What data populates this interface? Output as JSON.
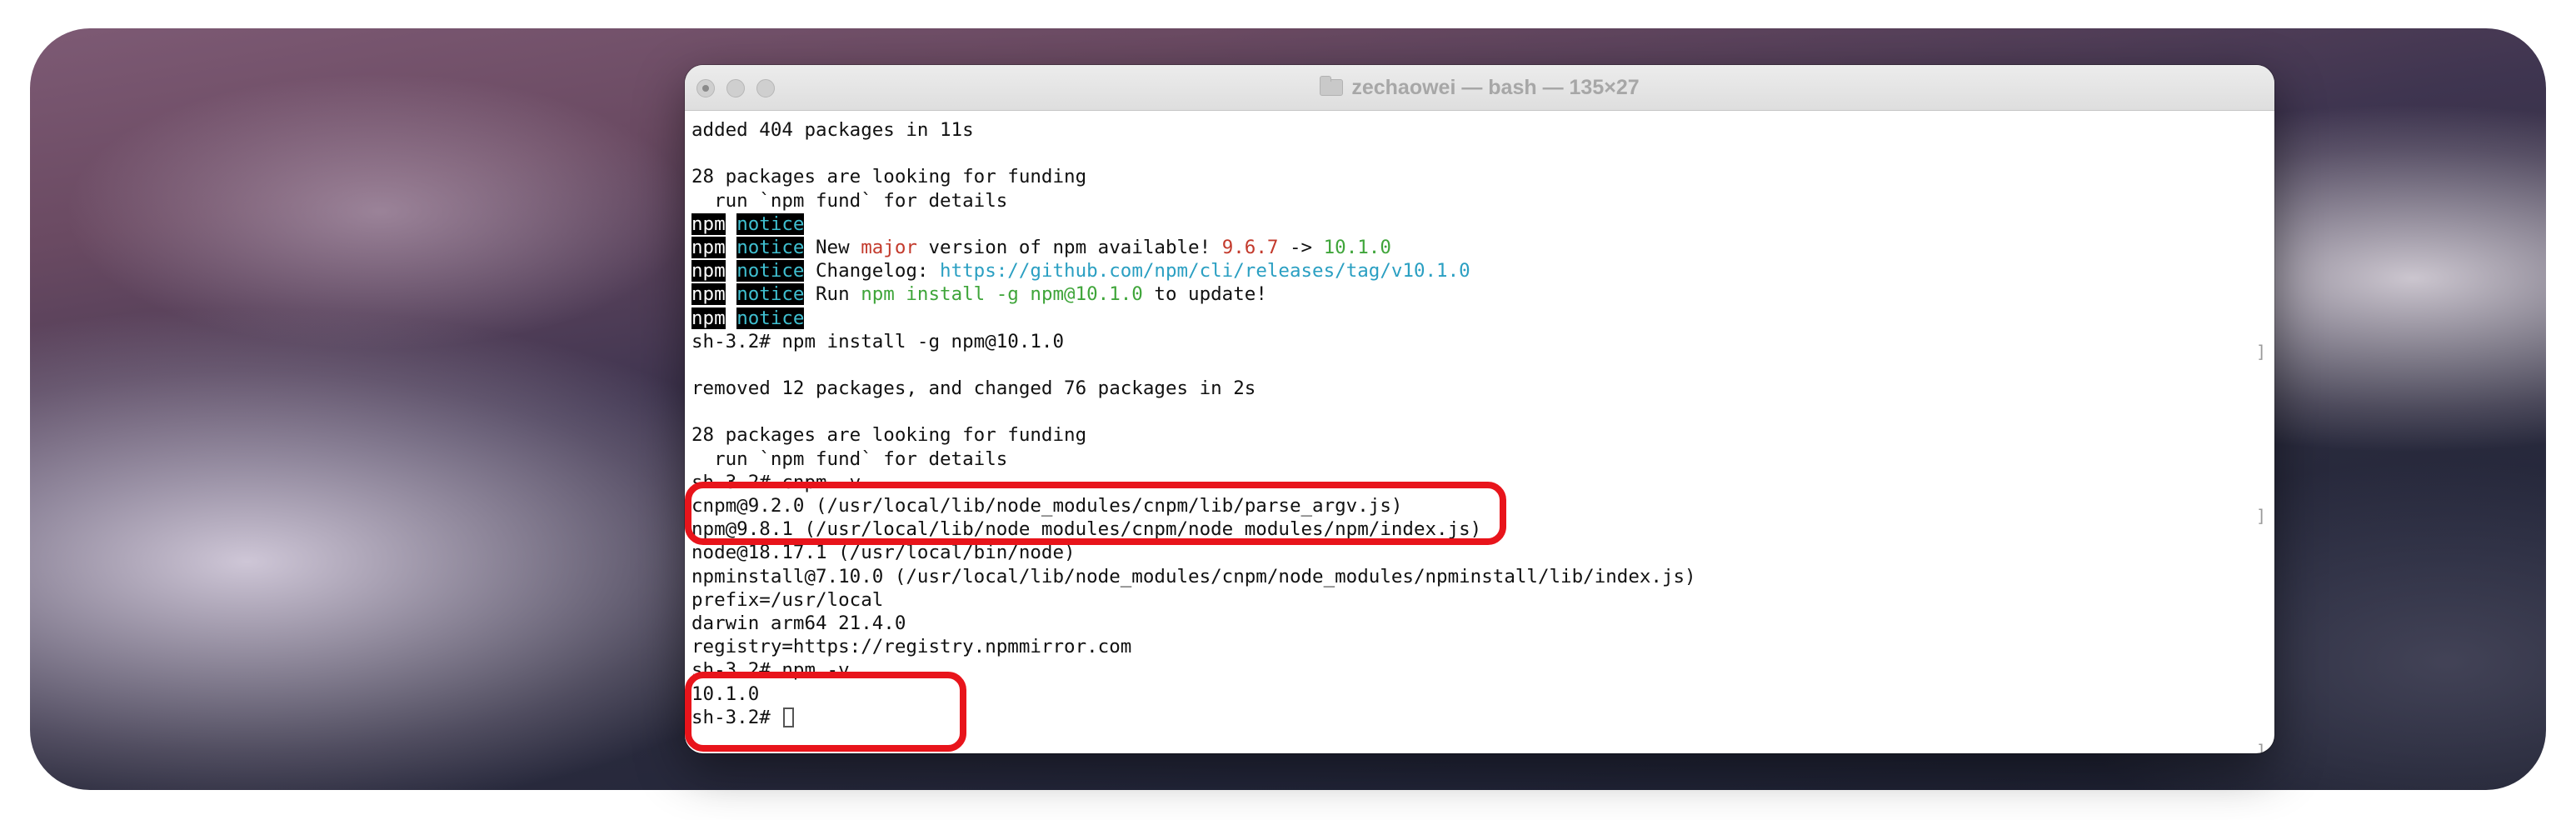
{
  "window": {
    "title": "zechaowei — bash — 135×27"
  },
  "terminal": {
    "lines": [
      "added 404 packages in 11s",
      "",
      "28 packages are looking for funding",
      "  run `npm fund` for details",
      "npm notice",
      "npm notice New major version of npm available! 9.6.7 -> 10.1.0",
      "npm notice Changelog: https://github.com/npm/cli/releases/tag/v10.1.0",
      "npm notice Run npm install -g npm@10.1.0 to update!",
      "npm notice",
      "sh-3.2# npm install -g npm@10.1.0",
      "",
      "removed 12 packages, and changed 76 packages in 2s",
      "",
      "28 packages are looking for funding",
      "  run `npm fund` for details",
      "sh-3.2# cnpm -v",
      "cnpm@9.2.0 (/usr/local/lib/node_modules/cnpm/lib/parse_argv.js)",
      "npm@9.8.1 (/usr/local/lib/node_modules/cnpm/node_modules/npm/index.js)",
      "node@18.17.1 (/usr/local/bin/node)",
      "npminstall@7.10.0 (/usr/local/lib/node_modules/cnpm/node_modules/npminstall/lib/index.js)",
      "prefix=/usr/local",
      "darwin arm64 21.4.0",
      "registry=https://registry.npmmirror.com",
      "sh-3.2# npm -v",
      "10.1.0",
      "sh-3.2# "
    ],
    "npm_label": "npm",
    "notice_label": "notice",
    "notice_new_a": " New ",
    "notice_new_major": "major",
    "notice_new_b": " version of npm available! ",
    "notice_old_version": "9.6.7",
    "notice_arrow": " -> ",
    "notice_new_version": "10.1.0",
    "changelog_label": " Changelog: ",
    "changelog_url": "https://github.com/npm/cli/releases/tag/v10.1.0",
    "run_label": " Run ",
    "run_command": "npm install -g npm@10.1.0",
    "run_suffix": " to update!",
    "prompt": "sh-3.2# "
  },
  "colors": {
    "highlight": "#e8141b",
    "major": "#c33a2c",
    "version_new": "#3fa53a",
    "url": "#2a9fc2"
  }
}
